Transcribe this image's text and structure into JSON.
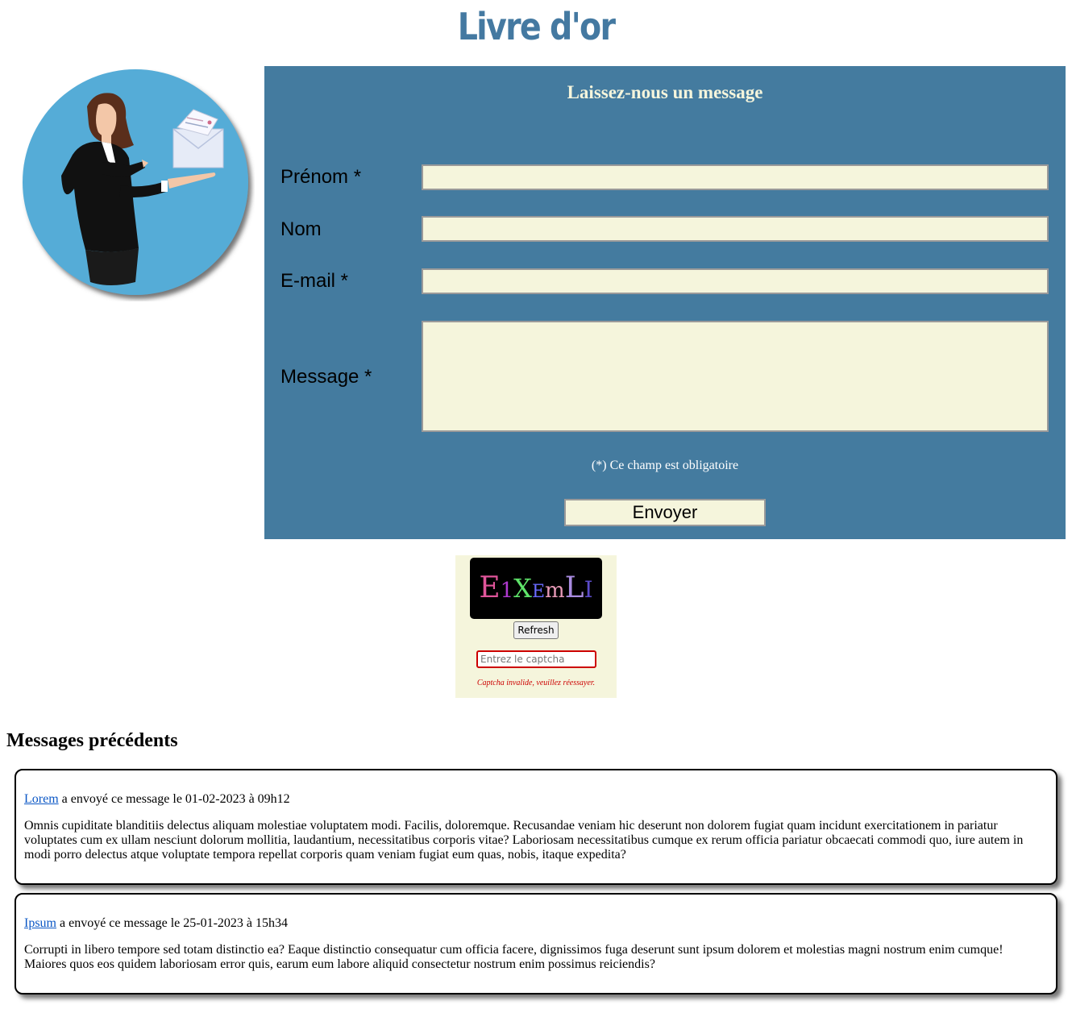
{
  "page": {
    "title": "Livre d'or"
  },
  "form": {
    "heading": "Laissez-nous un message",
    "fields": [
      {
        "label": "Prénom *",
        "value": ""
      },
      {
        "label": "Nom",
        "value": ""
      },
      {
        "label": "E-mail *",
        "value": ""
      },
      {
        "label": "Message *",
        "value": ""
      }
    ],
    "required_note": "(*) Ce champ est obligatoire",
    "submit_label": "Envoyer"
  },
  "captcha": {
    "characters": [
      {
        "char": "E",
        "color": "#e0559a"
      },
      {
        "char": "1",
        "color": "#b03ad0"
      },
      {
        "char": "X",
        "color": "#5fe36a"
      },
      {
        "char": "E",
        "color": "#6a6aff"
      },
      {
        "char": "m",
        "color": "#e89ab8"
      },
      {
        "char": "L",
        "color": "#a98be0"
      },
      {
        "char": "I",
        "color": "#5b4bc9"
      }
    ],
    "refresh_label": "Refresh",
    "input_placeholder": "Entrez le captcha",
    "error": "Captcha invalide, veuillez réessayer."
  },
  "messages": {
    "title": "Messages précédents",
    "items": [
      {
        "author": "Lorem",
        "meta": " a envoyé ce message le 01-02-2023 à 09h12",
        "body": "Omnis cupiditate blanditiis delectus aliquam molestiae voluptatem modi. Facilis, doloremque. Recusandae veniam hic deserunt non dolorem fugiat quam incidunt exercitationem in pariatur voluptates cum ex ullam nesciunt dolorum mollitia, laudantium, necessitatibus corporis vitae? Laboriosam necessitatibus cumque ex rerum officia pariatur obcaecati commodi quo, iure autem in modi porro delectus atque voluptate tempora repellat corporis quam veniam fugiat eum quas, nobis, itaque expedita?"
      },
      {
        "author": "Ipsum",
        "meta": " a envoyé ce message le 25-01-2023 à 15h34",
        "body": "Corrupti in libero tempore sed totam distinctio ea? Eaque distinctio consequatur cum officia facere, dignissimos fuga deserunt sunt ipsum dolorem et molestias magni nostrum enim cumque! Maiores quos eos quidem laboriosam error quis, earum eum labore aliquid consectetur nostrum enim possimus reiciendis?"
      }
    ]
  },
  "colors": {
    "accent": "#447b9f",
    "field_background": "#f5f5dc",
    "error": "#cc0000",
    "link": "#0b57c5"
  },
  "icons": {
    "illustration": "businesswoman-presenting-envelope-icon"
  }
}
